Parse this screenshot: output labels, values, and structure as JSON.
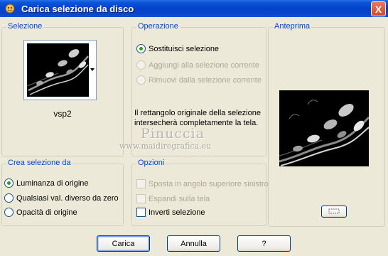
{
  "window": {
    "title": "Carica selezione da disco",
    "close_label": "X"
  },
  "selection": {
    "group_title": "Selezione",
    "file_name": "vsp2"
  },
  "operation": {
    "group_title": "Operazione",
    "options": [
      {
        "label": "Sostituisci selezione",
        "checked": true,
        "enabled": true
      },
      {
        "label": "Aggiungi alla selezione corrente",
        "checked": false,
        "enabled": false
      },
      {
        "label": "Rimuovi dalla selezione corrente",
        "checked": false,
        "enabled": false
      }
    ],
    "note_line1": "Il rettangolo originale della selezione",
    "note_line2": "intersecherà completamente la tela."
  },
  "preview": {
    "group_title": "Anteprima"
  },
  "create_from": {
    "group_title": "Crea selezione da",
    "options": [
      {
        "label": "Luminanza di origine",
        "checked": true
      },
      {
        "label": "Qualsiasi val. diverso da zero",
        "checked": false
      },
      {
        "label": "Opacità di origine",
        "checked": false
      }
    ]
  },
  "options": {
    "group_title": "Opzioni",
    "items": [
      {
        "label": "Sposta in angolo superiore sinistro",
        "checked": false,
        "enabled": false
      },
      {
        "label": "Espandi sulla tela",
        "checked": false,
        "enabled": false
      },
      {
        "label": "Inverti selezione",
        "checked": false,
        "enabled": true
      }
    ]
  },
  "watermark": {
    "name": "Pinuccia",
    "url": "www.maidiregrafica.eu"
  },
  "buttons": {
    "load": "Carica",
    "cancel": "Annulla",
    "help": "?"
  }
}
